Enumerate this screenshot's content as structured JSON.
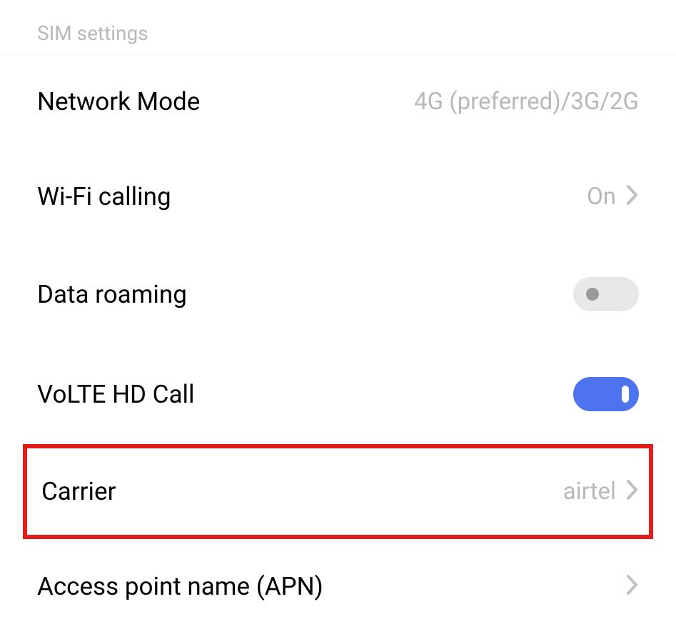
{
  "section": {
    "title": "SIM settings"
  },
  "rows": {
    "network_mode": {
      "label": "Network Mode",
      "value": "4G (preferred)/3G/2G"
    },
    "wifi_calling": {
      "label": "Wi-Fi calling",
      "value": "On"
    },
    "data_roaming": {
      "label": "Data roaming",
      "toggle_state": "off"
    },
    "volte": {
      "label": "VoLTE HD Call",
      "toggle_state": "on"
    },
    "carrier": {
      "label": "Carrier",
      "value": "airtel"
    },
    "apn": {
      "label": "Access point name (APN)"
    }
  }
}
